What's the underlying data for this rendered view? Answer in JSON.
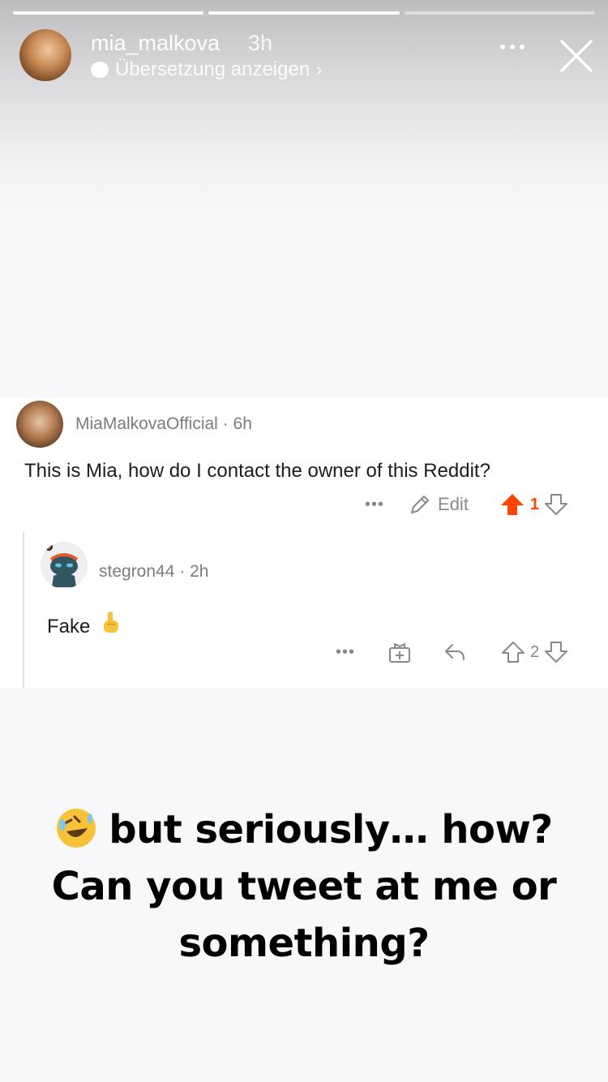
{
  "story": {
    "progress": [
      1.0,
      1.0,
      0.0
    ],
    "username": "mia_malkova",
    "time": "3h",
    "translate_label": "Übersetzung anzeigen",
    "translate_chevron": "›"
  },
  "reddit": {
    "post": {
      "author": "MiaMalkovaOfficial",
      "separator": "·",
      "age": "6h",
      "text": "This is Mia, how do I contact the owner of this Reddit?",
      "more": "•••",
      "edit_label": "Edit",
      "votes": "1"
    },
    "reply": {
      "author": "stegron44",
      "separator": "·",
      "age": "2h",
      "text": "Fake",
      "more": "•••",
      "votes": "2"
    }
  },
  "caption": {
    "line1": "but seriously… how?",
    "line2": "Can you tweet at me or",
    "line3": "something?"
  },
  "colors": {
    "upvote_active": "#ff4500",
    "meta_gray": "#7c7c7c",
    "icon_gray": "#878a8c"
  }
}
